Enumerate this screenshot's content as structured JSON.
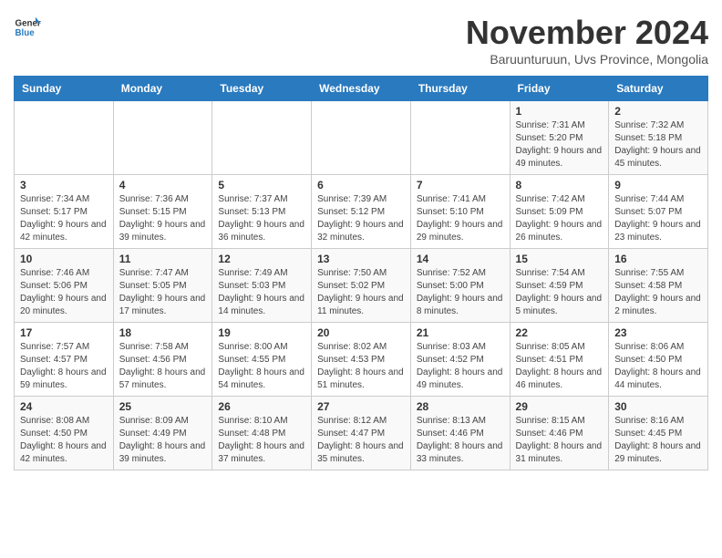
{
  "logo": {
    "general": "General",
    "blue": "Blue"
  },
  "header": {
    "month": "November 2024",
    "location": "Baruunturuun, Uvs Province, Mongolia"
  },
  "weekdays": [
    "Sunday",
    "Monday",
    "Tuesday",
    "Wednesday",
    "Thursday",
    "Friday",
    "Saturday"
  ],
  "weeks": [
    [
      {
        "day": "",
        "info": ""
      },
      {
        "day": "",
        "info": ""
      },
      {
        "day": "",
        "info": ""
      },
      {
        "day": "",
        "info": ""
      },
      {
        "day": "",
        "info": ""
      },
      {
        "day": "1",
        "info": "Sunrise: 7:31 AM\nSunset: 5:20 PM\nDaylight: 9 hours and 49 minutes."
      },
      {
        "day": "2",
        "info": "Sunrise: 7:32 AM\nSunset: 5:18 PM\nDaylight: 9 hours and 45 minutes."
      }
    ],
    [
      {
        "day": "3",
        "info": "Sunrise: 7:34 AM\nSunset: 5:17 PM\nDaylight: 9 hours and 42 minutes."
      },
      {
        "day": "4",
        "info": "Sunrise: 7:36 AM\nSunset: 5:15 PM\nDaylight: 9 hours and 39 minutes."
      },
      {
        "day": "5",
        "info": "Sunrise: 7:37 AM\nSunset: 5:13 PM\nDaylight: 9 hours and 36 minutes."
      },
      {
        "day": "6",
        "info": "Sunrise: 7:39 AM\nSunset: 5:12 PM\nDaylight: 9 hours and 32 minutes."
      },
      {
        "day": "7",
        "info": "Sunrise: 7:41 AM\nSunset: 5:10 PM\nDaylight: 9 hours and 29 minutes."
      },
      {
        "day": "8",
        "info": "Sunrise: 7:42 AM\nSunset: 5:09 PM\nDaylight: 9 hours and 26 minutes."
      },
      {
        "day": "9",
        "info": "Sunrise: 7:44 AM\nSunset: 5:07 PM\nDaylight: 9 hours and 23 minutes."
      }
    ],
    [
      {
        "day": "10",
        "info": "Sunrise: 7:46 AM\nSunset: 5:06 PM\nDaylight: 9 hours and 20 minutes."
      },
      {
        "day": "11",
        "info": "Sunrise: 7:47 AM\nSunset: 5:05 PM\nDaylight: 9 hours and 17 minutes."
      },
      {
        "day": "12",
        "info": "Sunrise: 7:49 AM\nSunset: 5:03 PM\nDaylight: 9 hours and 14 minutes."
      },
      {
        "day": "13",
        "info": "Sunrise: 7:50 AM\nSunset: 5:02 PM\nDaylight: 9 hours and 11 minutes."
      },
      {
        "day": "14",
        "info": "Sunrise: 7:52 AM\nSunset: 5:00 PM\nDaylight: 9 hours and 8 minutes."
      },
      {
        "day": "15",
        "info": "Sunrise: 7:54 AM\nSunset: 4:59 PM\nDaylight: 9 hours and 5 minutes."
      },
      {
        "day": "16",
        "info": "Sunrise: 7:55 AM\nSunset: 4:58 PM\nDaylight: 9 hours and 2 minutes."
      }
    ],
    [
      {
        "day": "17",
        "info": "Sunrise: 7:57 AM\nSunset: 4:57 PM\nDaylight: 8 hours and 59 minutes."
      },
      {
        "day": "18",
        "info": "Sunrise: 7:58 AM\nSunset: 4:56 PM\nDaylight: 8 hours and 57 minutes."
      },
      {
        "day": "19",
        "info": "Sunrise: 8:00 AM\nSunset: 4:55 PM\nDaylight: 8 hours and 54 minutes."
      },
      {
        "day": "20",
        "info": "Sunrise: 8:02 AM\nSunset: 4:53 PM\nDaylight: 8 hours and 51 minutes."
      },
      {
        "day": "21",
        "info": "Sunrise: 8:03 AM\nSunset: 4:52 PM\nDaylight: 8 hours and 49 minutes."
      },
      {
        "day": "22",
        "info": "Sunrise: 8:05 AM\nSunset: 4:51 PM\nDaylight: 8 hours and 46 minutes."
      },
      {
        "day": "23",
        "info": "Sunrise: 8:06 AM\nSunset: 4:50 PM\nDaylight: 8 hours and 44 minutes."
      }
    ],
    [
      {
        "day": "24",
        "info": "Sunrise: 8:08 AM\nSunset: 4:50 PM\nDaylight: 8 hours and 42 minutes."
      },
      {
        "day": "25",
        "info": "Sunrise: 8:09 AM\nSunset: 4:49 PM\nDaylight: 8 hours and 39 minutes."
      },
      {
        "day": "26",
        "info": "Sunrise: 8:10 AM\nSunset: 4:48 PM\nDaylight: 8 hours and 37 minutes."
      },
      {
        "day": "27",
        "info": "Sunrise: 8:12 AM\nSunset: 4:47 PM\nDaylight: 8 hours and 35 minutes."
      },
      {
        "day": "28",
        "info": "Sunrise: 8:13 AM\nSunset: 4:46 PM\nDaylight: 8 hours and 33 minutes."
      },
      {
        "day": "29",
        "info": "Sunrise: 8:15 AM\nSunset: 4:46 PM\nDaylight: 8 hours and 31 minutes."
      },
      {
        "day": "30",
        "info": "Sunrise: 8:16 AM\nSunset: 4:45 PM\nDaylight: 8 hours and 29 minutes."
      }
    ]
  ]
}
